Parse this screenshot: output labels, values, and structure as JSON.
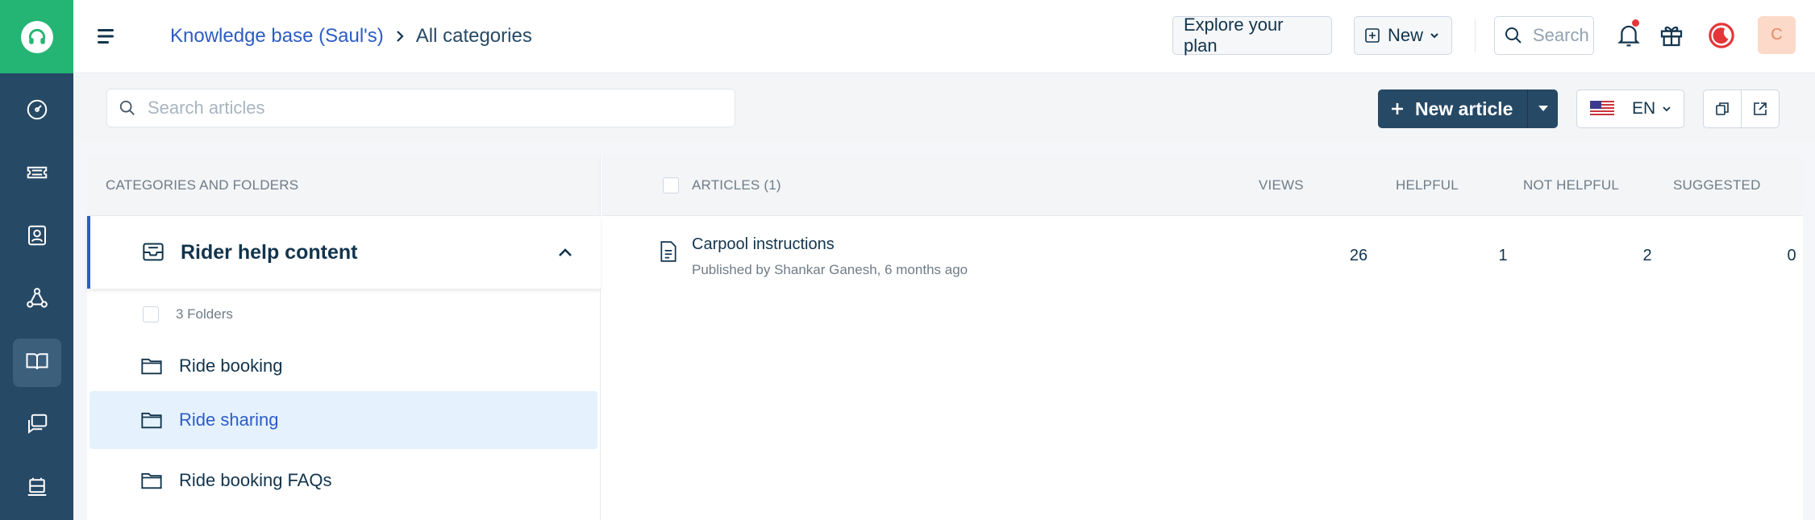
{
  "header": {
    "breadcrumb_link": "Knowledge base (Saul's)",
    "breadcrumb_current": "All categories",
    "explore_label": "Explore your plan",
    "new_label": "New",
    "search_placeholder": "Search",
    "avatar_initial": "C"
  },
  "sidebar": {
    "items": [
      {
        "icon": "dashboard-icon"
      },
      {
        "icon": "tickets-icon"
      },
      {
        "icon": "contacts-icon"
      },
      {
        "icon": "groups-icon"
      },
      {
        "icon": "knowledge-base-icon",
        "active": true
      },
      {
        "icon": "conversations-icon"
      },
      {
        "icon": "admin-icon"
      }
    ]
  },
  "toolbar": {
    "search_placeholder": "Search articles",
    "new_article_label": "New article",
    "language": "EN"
  },
  "categories": {
    "header": "CATEGORIES AND FOLDERS",
    "category_name": "Rider help content",
    "folder_count_label": "3 Folders",
    "folders": [
      {
        "label": "Ride booking",
        "active": false
      },
      {
        "label": "Ride sharing",
        "active": true
      },
      {
        "label": "Ride booking FAQs",
        "active": false
      }
    ]
  },
  "articles": {
    "header": "ARTICLES (1)",
    "columns": [
      "VIEWS",
      "HELPFUL",
      "NOT HELPFUL",
      "SUGGESTED"
    ],
    "rows": [
      {
        "title": "Carpool instructions",
        "meta": "Published by Shankar Ganesh, 6 months ago",
        "views": "26",
        "helpful": "1",
        "not_helpful": "2",
        "suggested": "0"
      }
    ]
  },
  "colors": {
    "rail": "#264966",
    "brand_green": "#24b474",
    "link_blue": "#2c5cc5",
    "primary_button": "#264966",
    "active_folder_bg": "#e5f2fd",
    "notification_dot": "#e43538"
  }
}
